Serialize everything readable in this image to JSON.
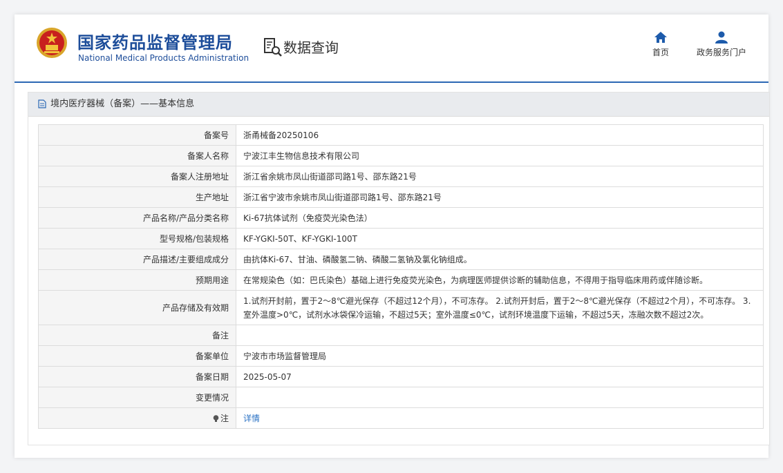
{
  "header": {
    "brand_cn": "国家药品监督管理局",
    "brand_en": "National Medical Products Administration",
    "query_label": "数据查询",
    "nav_home": "首页",
    "nav_portal": "政务服务门户",
    "accent_color": "#1d4d9a"
  },
  "panel": {
    "title": "境内医疗器械（备案）——基本信息"
  },
  "rows": [
    {
      "label": "备案号",
      "value": "浙甬械备20250106"
    },
    {
      "label": "备案人名称",
      "value": "宁波江丰生物信息技术有限公司"
    },
    {
      "label": "备案人注册地址",
      "value": "浙江省余姚市凤山街道邵司路1号、邵东路21号"
    },
    {
      "label": "生产地址",
      "value": "浙江省宁波市余姚市凤山街道邵司路1号、邵东路21号"
    },
    {
      "label": "产品名称/产品分类名称",
      "value": "Ki-67抗体试剂（免疫荧光染色法）"
    },
    {
      "label": "型号规格/包装规格",
      "value": "KF-YGKI-50T、KF-YGKI-100T"
    },
    {
      "label": "产品描述/主要组成成分",
      "value": "由抗体Ki-67、甘油、磷酸氢二钠、磷酸二氢钠及氯化钠组成。"
    },
    {
      "label": "预期用途",
      "value": "在常规染色（如：巴氏染色）基础上进行免疫荧光染色，为病理医师提供诊断的辅助信息，不得用于指导临床用药或伴随诊断。"
    },
    {
      "label": "产品存储及有效期",
      "value": "1.试剂开封前，置于2～8℃避光保存（不超过12个月），不可冻存。 2.试剂开封后，置于2～8℃避光保存（不超过2个月），不可冻存。 3.室外温度>0℃，试剂水冰袋保冷运输，不超过5天；室外温度≤0℃，试剂环境温度下运输，不超过5天，冻融次数不超过2次。"
    },
    {
      "label": "备注",
      "value": ""
    },
    {
      "label": "备案单位",
      "value": "宁波市市场监督管理局"
    },
    {
      "label": "备案日期",
      "value": "2025-05-07"
    },
    {
      "label": "变更情况",
      "value": ""
    },
    {
      "label": "注",
      "value": "详情"
    }
  ]
}
